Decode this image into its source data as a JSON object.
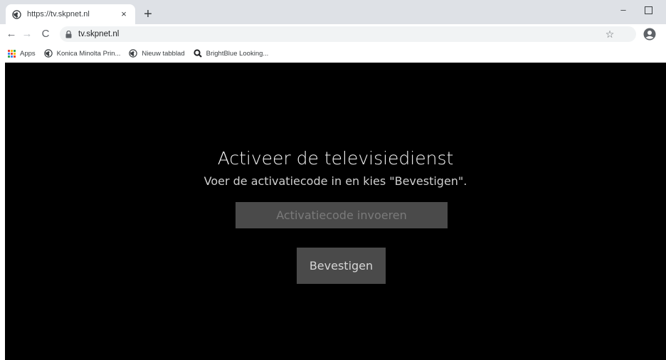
{
  "browser": {
    "tab": {
      "title": "https://tv.skpnet.nl",
      "close": "×"
    },
    "new_tab": "+",
    "window_controls": {
      "minimize": "–"
    },
    "nav": {
      "back": "←",
      "forward": "→",
      "reload": "C"
    },
    "address": {
      "url": "tv.skpnet.nl"
    },
    "star": "☆",
    "bookmarks": [
      {
        "label": "Apps",
        "icon": "apps-grid-icon"
      },
      {
        "label": "Konica Minolta Prin...",
        "icon": "globe-icon"
      },
      {
        "label": "Nieuw tabblad",
        "icon": "globe-icon"
      },
      {
        "label": "BrightBlue Looking...",
        "icon": "search-icon"
      }
    ]
  },
  "page": {
    "title": "Activeer de televisiedienst",
    "subtitle": "Voer de activatiecode in en kies \"Bevestigen\".",
    "code_placeholder": "Activatiecode invoeren",
    "confirm_label": "Bevestigen"
  }
}
